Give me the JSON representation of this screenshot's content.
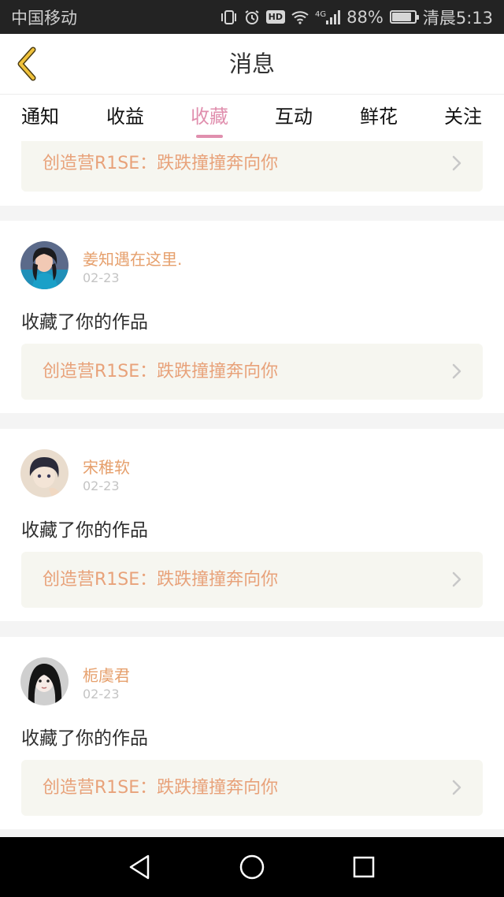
{
  "status_bar": {
    "carrier": "中国移动",
    "network": "4G",
    "battery": "88%",
    "battery_level": 0.88,
    "time": "清晨5:13",
    "hd_label": "HD",
    "icons": [
      "vibrate-icon",
      "alarm-icon",
      "hd-icon",
      "wifi-icon",
      "signal-icon",
      "battery-icon"
    ]
  },
  "header": {
    "title": "消息",
    "back_icon": "chevron-left-icon"
  },
  "tabs": [
    {
      "label": "通知",
      "active": false
    },
    {
      "label": "收益",
      "active": false
    },
    {
      "label": "收藏",
      "active": true
    },
    {
      "label": "互动",
      "active": false
    },
    {
      "label": "鲜花",
      "active": false
    },
    {
      "label": "关注",
      "active": false
    }
  ],
  "feed": {
    "partial_work_title": "创造营R1SE：跌跌撞撞奔向你",
    "items": [
      {
        "username": "姜知遇在这里.",
        "date": "02-23",
        "action": "收藏了你的作品",
        "work_title": "创造营R1SE：跌跌撞撞奔向你"
      },
      {
        "username": "宋稚软",
        "date": "02-23",
        "action": "收藏了你的作品",
        "work_title": "创造营R1SE：跌跌撞撞奔向你"
      },
      {
        "username": "栀虞君",
        "date": "02-23",
        "action": "收藏了你的作品",
        "work_title": "创造营R1SE：跌跌撞撞奔向你"
      }
    ]
  },
  "colors": {
    "accent": "#e08fae",
    "username": "#e6a06d",
    "work_title": "#e8a27a",
    "back_icon": "#e8b43a"
  },
  "nav": {
    "icons": [
      "back-triangle-icon",
      "home-circle-icon",
      "recents-square-icon"
    ]
  }
}
